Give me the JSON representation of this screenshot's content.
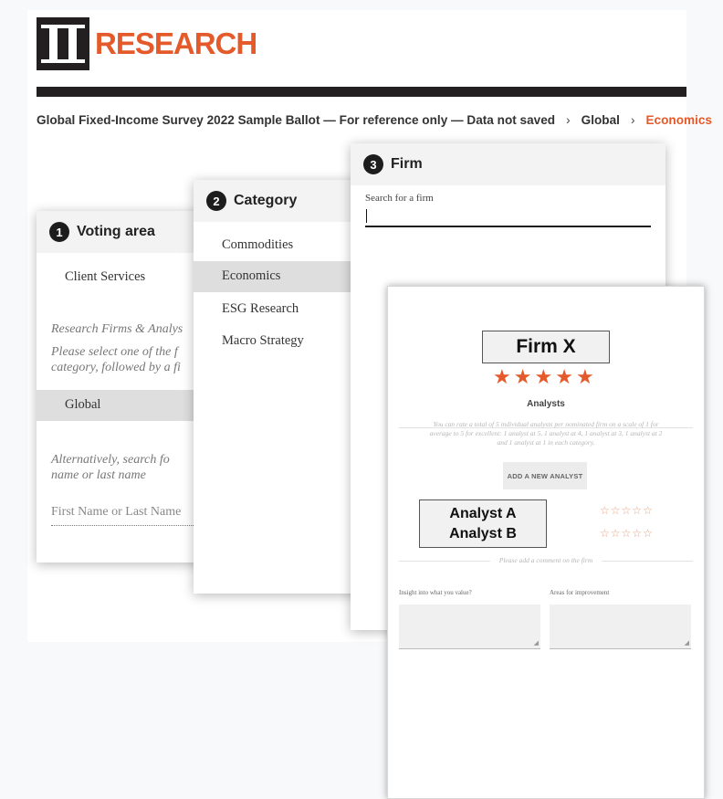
{
  "brand": {
    "logo_text": "RESEARCH",
    "accent_color": "#e55a2b"
  },
  "breadcrumb": {
    "items": [
      "Global Fixed-Income Survey 2022 Sample Ballot — For reference only — Data not saved",
      "Global",
      "Economics"
    ],
    "separator": "›"
  },
  "voting_area": {
    "step": "1",
    "title": "Voting area",
    "first_item": "Client Services",
    "note_title": "Research Firms & Analys",
    "note_line1": "Please select one of the f",
    "note_line2": "category, followed by a fi",
    "selected_item": "Global",
    "alt_line1": "Alternatively,  search  fo",
    "alt_line2": "name or last name",
    "name_placeholder": "First Name or Last Name"
  },
  "category": {
    "step": "2",
    "title": "Category",
    "items": [
      "Commodities",
      "Economics",
      "ESG Research",
      "Macro Strategy"
    ],
    "selected": "Economics"
  },
  "firm": {
    "step": "3",
    "title": "Firm",
    "search_label": "Search for a firm",
    "search_value": ""
  },
  "rating_form": {
    "firm_name": "Firm X",
    "firm_rating": 5,
    "firm_rating_max": 5,
    "analysts_title": "Analysts",
    "instructions_line1": "You can rate a total of 5 individual analysts per nominated firm on a scale of 1 for",
    "instructions_line2": "average to 5 for excellent: 1 analyst at 5, 1 analyst at 4, 1 analyst at 3, 1 analyst at 2",
    "instructions_line3": "and 1 analyst at 1 in each category.",
    "add_button": "ADD A NEW ANALYST",
    "analysts": [
      {
        "name": "Analyst A",
        "rating": 0,
        "max": 5
      },
      {
        "name": "Analyst B",
        "rating": 0,
        "max": 5
      }
    ],
    "comment_note": "Please add a comment on the firm",
    "insight_label": "Insight into what you value?",
    "improvement_label": "Areas for improvement"
  }
}
